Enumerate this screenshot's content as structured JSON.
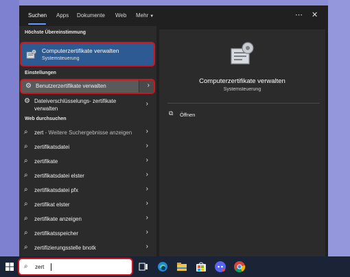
{
  "tabs": [
    {
      "label": "Suchen",
      "active": true
    },
    {
      "label": "Apps",
      "active": false
    },
    {
      "label": "Dokumente",
      "active": false
    },
    {
      "label": "Web",
      "active": false
    },
    {
      "label": "Mehr",
      "active": false,
      "icon": "chevron-down-icon"
    }
  ],
  "toolbar": {
    "more_icon": "⋯",
    "close_icon": "✕"
  },
  "sections": {
    "best_match": "Höchste Übereinstimmung",
    "settings": "Einstellungen",
    "web": "Web durchsuchen"
  },
  "best_match": {
    "title": "Computerzertifikate verwalten",
    "subtitle": "Systemsteuerung",
    "icon": "certificate-icon"
  },
  "settings_items": [
    {
      "label": "Benutzerzertifikate verwalten",
      "icon": "certificate-user-icon"
    },
    {
      "label": "Dateiverschlüsselungs- zertifikate verwalten",
      "icon": "certificate-user-icon"
    }
  ],
  "web_items": [
    {
      "label": "zert",
      "suffix": " - Weitere Suchergebnisse anzeigen"
    },
    {
      "label": "zertifikatsdatei",
      "suffix": ""
    },
    {
      "label": "zertifikate",
      "suffix": ""
    },
    {
      "label": "zertifikatsdatei elster",
      "suffix": ""
    },
    {
      "label": "zertifikatsdatei pfx",
      "suffix": ""
    },
    {
      "label": "zertifikat elster",
      "suffix": ""
    },
    {
      "label": "zertifikate anzeigen",
      "suffix": ""
    },
    {
      "label": "zertifikatsspeicher",
      "suffix": ""
    },
    {
      "label": "zertifizierungsstelle bnotk",
      "suffix": ""
    }
  ],
  "preview": {
    "title": "Computerzertifikate verwalten",
    "subtitle": "Systemsteuerung",
    "open_label": "Öffnen"
  },
  "taskbar": {
    "search_value": "zert",
    "apps": [
      "task-view-icon",
      "edge-icon",
      "file-explorer-icon",
      "store-icon",
      "discord-icon",
      "chrome-icon"
    ]
  },
  "colors": {
    "accent": "#2d5a93",
    "highlight_border": "#d4141c",
    "tab_underline": "#5da0ff"
  }
}
